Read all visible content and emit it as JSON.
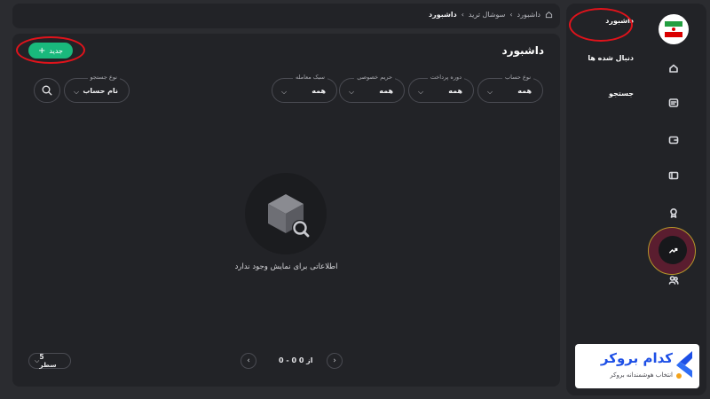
{
  "breadcrumb": {
    "items": [
      "داشبورد",
      "سوشال ترید",
      "داشبورد"
    ],
    "separator": "›"
  },
  "main": {
    "title": "داشبورد",
    "new_button": {
      "label": "جدید",
      "icon": "plus-icon"
    },
    "filters": [
      {
        "label": "نوع حساب",
        "value": "همه"
      },
      {
        "label": "دوره پرداخت",
        "value": "همه"
      },
      {
        "label": "حریم خصوصی",
        "value": "همه"
      },
      {
        "label": "سبک معامله",
        "value": "همه"
      }
    ],
    "search_type": {
      "label": "نوع جستجو",
      "value": "نام حساب"
    },
    "empty": {
      "message": "اطلاعاتی برای نمایش وجود ندارد",
      "icon": "empty-box-search-icon"
    },
    "pagination": {
      "range": "0 - 0 از 0",
      "rows_per_page": "5 سطر"
    }
  },
  "sidebar": {
    "items": [
      {
        "label": "داشبورد",
        "active": true
      },
      {
        "label": "دنبال شده ها"
      },
      {
        "label": "جستجو"
      }
    ],
    "rail_icons": [
      "home-icon",
      "message-icon",
      "wallet-icon",
      "ticket-icon",
      "award-icon",
      "trending-up-icon",
      "users-icon"
    ]
  },
  "brand": {
    "name": "کدام بروکر",
    "tagline": "انتخاب هوشمندانه بروکر"
  },
  "colors": {
    "accent": "#19b97c",
    "highlight": "#e0131b",
    "brand": "#1d4fe6"
  }
}
